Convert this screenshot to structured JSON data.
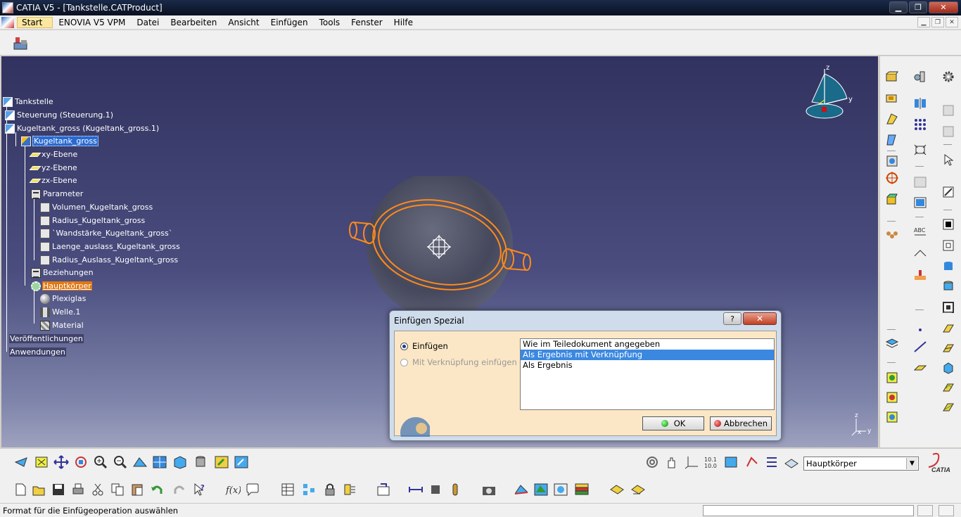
{
  "window": {
    "title": "CATIA V5 - [Tankstelle.CATProduct]",
    "minimize": "▁",
    "restore": "❐",
    "close": "✕"
  },
  "menu": {
    "items": [
      "Start",
      "ENOVIA V5 VPM",
      "Datei",
      "Bearbeiten",
      "Ansicht",
      "Einfügen",
      "Tools",
      "Fenster",
      "Hilfe"
    ]
  },
  "tree": {
    "root": "Tankstelle",
    "steuerung": "Steuerung (Steuerung.1)",
    "kugeltank_instance": "Kugeltank_gross (Kugeltank_gross.1)",
    "kugeltank_part": "Kugeltank_gross",
    "xy": "xy-Ebene",
    "yz": "yz-Ebene",
    "zx": "zx-Ebene",
    "parameter": "Parameter",
    "p1": "Volumen_Kugeltank_gross",
    "p2": "Radius_Kugeltank_gross",
    "p3": "`Wandstärke_Kugeltank_gross`",
    "p4": "Laenge_auslass_Kugeltank_gross",
    "p5": "Radius_Auslass_Kugeltank_gross",
    "beziehungen": "Beziehungen",
    "hauptkoerper": "Hauptkörper",
    "plexiglas": "Plexiglas",
    "welle": "Welle.1",
    "material": "Material",
    "veroeffentlichungen": "Veröffentlichungen",
    "anwendungen": "Anwendungen"
  },
  "compass": {
    "z": "z",
    "y": "y"
  },
  "axis_small": {
    "z": "z",
    "x": "x",
    "y": "y"
  },
  "dialog": {
    "title": "Einfügen Spezial",
    "help": "?",
    "close": "✕",
    "radio_insert": "Einfügen",
    "radio_link": "Mit Verknüpfung einfügen",
    "options": [
      "Wie im Teiledokument angegeben",
      "Als Ergebnis mit Verknüpfung",
      "Als Ergebnis"
    ],
    "selected_index": 1,
    "ok": "OK",
    "cancel": "Abbrechen"
  },
  "layer_combo": {
    "value": "Hauptkörper"
  },
  "brand": {
    "logo_text": "CATIA"
  },
  "status": {
    "message": "Format für die Einfügeoperation auswählen"
  }
}
